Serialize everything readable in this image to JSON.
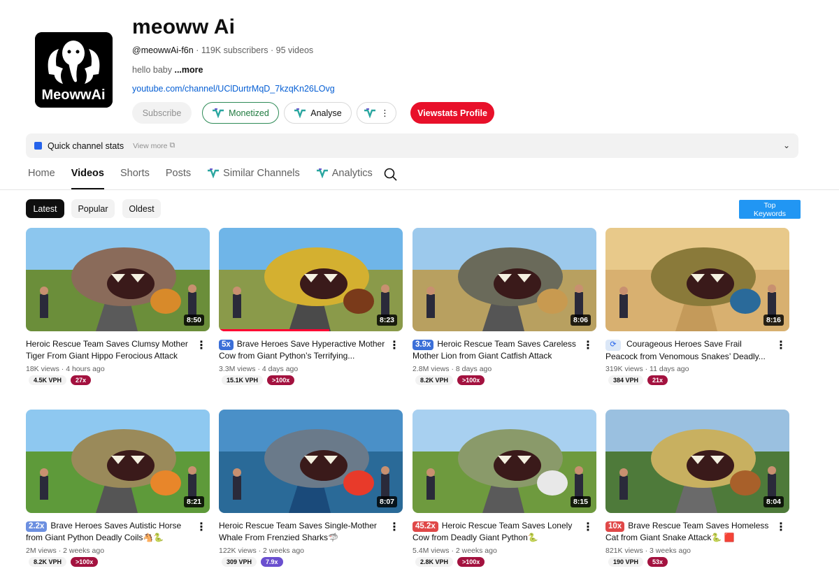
{
  "channel": {
    "name": "meoww Ai",
    "logo_text": "MeowwAi",
    "handle": "@meowwAi-f6n",
    "subscribers": "119K subscribers",
    "videos_count": "95 videos",
    "separator": "·",
    "description": "hello baby",
    "more_label": "...more",
    "link": "youtube.com/channel/UClDurtrMqD_7kzqKn26LOvg"
  },
  "actions": {
    "subscribe": "Subscribe",
    "monetized": "Monetized",
    "analyse": "Analyse",
    "more_dots": "⋮",
    "viewstats": "Viewstats Profile"
  },
  "stats_bar": {
    "label": "Quick channel stats",
    "view_more": "View more",
    "ext_icon": "⧉",
    "chevron": "⌄"
  },
  "tabs": {
    "home": "Home",
    "videos": "Videos",
    "shorts": "Shorts",
    "posts": "Posts",
    "similar": "Similar Channels",
    "analytics": "Analytics"
  },
  "chips": {
    "latest": "Latest",
    "popular": "Popular",
    "oldest": "Oldest"
  },
  "top_keywords": {
    "line1": "Top",
    "line2": "Keywords"
  },
  "colors": {
    "accent_red": "#e8102a",
    "monetized_green": "#1f7a3f",
    "link_blue": "#065fd4",
    "top_keywords_blue": "#2196f3"
  },
  "videos": [
    {
      "title": "Heroic Rescue Team Saves Clumsy Mother Tiger From Giant Hippo Ferocious Attack",
      "outlier": "",
      "outlier_color": "",
      "duration": "8:50",
      "views": "18K views",
      "age": "4 hours ago",
      "vph": "4.5K VPH",
      "multiplier": "27x",
      "mult_color": "#a3123f",
      "progress": 0
    },
    {
      "title": "Brave Heroes Save Hyperactive Mother Cow from Giant Python’s Terrifying...",
      "outlier": "5x",
      "outlier_color": "#3b6fd8",
      "duration": "8:23",
      "views": "3.3M views",
      "age": "4 days ago",
      "vph": "15.1K VPH",
      "multiplier": ">100x",
      "mult_color": "#a3123f",
      "progress": 0.6
    },
    {
      "title": "Heroic Rescue Team Saves Careless Mother Lion from Giant Catfish Attack",
      "outlier": "3.9x",
      "outlier_color": "#3b6fd8",
      "duration": "8:06",
      "views": "2.8M views",
      "age": "8 days ago",
      "vph": "8.2K VPH",
      "multiplier": ">100x",
      "mult_color": "#a3123f",
      "progress": 0
    },
    {
      "title": "Courageous Heroes Save Frail Peacock from Venomous Snakes’ Deadly...",
      "outlier": "⟳",
      "outlier_color": "refresh",
      "duration": "8:16",
      "views": "319K views",
      "age": "11 days ago",
      "vph": "384 VPH",
      "multiplier": "21x",
      "mult_color": "#a3123f",
      "progress": 0
    },
    {
      "title": "Brave Heroes Saves Autistic Horse from Giant Python Deadly Coils🐴🐍",
      "outlier": "2.2x",
      "outlier_color": "#6c8fe0",
      "duration": "8:21",
      "views": "2M views",
      "age": "2 weeks ago",
      "vph": "8.2K VPH",
      "multiplier": ">100x",
      "mult_color": "#a3123f",
      "progress": 0
    },
    {
      "title": "Heroic Rescue Team Saves Single-Mother Whale From Frenzied Sharks🦈",
      "outlier": "",
      "outlier_color": "",
      "duration": "8:07",
      "views": "122K views",
      "age": "2 weeks ago",
      "vph": "309 VPH",
      "multiplier": "7.9x",
      "mult_color": "#6a4fcf",
      "progress": 0
    },
    {
      "title": "Heroic Rescue Team Saves Lonely Cow from Deadly Giant Python🐍",
      "outlier": "45.2x",
      "outlier_color": "#e04848",
      "duration": "8:15",
      "views": "5.4M views",
      "age": "2 weeks ago",
      "vph": "2.8K VPH",
      "multiplier": ">100x",
      "mult_color": "#a3123f",
      "progress": 0
    },
    {
      "title": "Brave Rescue Team Saves Homeless Cat from Giant Snake Attack🐍 🟥",
      "outlier": "10x",
      "outlier_color": "#e04848",
      "duration": "8:04",
      "views": "821K views",
      "age": "3 weeks ago",
      "vph": "190 VPH",
      "multiplier": "53x",
      "mult_color": "#a3123f",
      "progress": 0
    }
  ]
}
